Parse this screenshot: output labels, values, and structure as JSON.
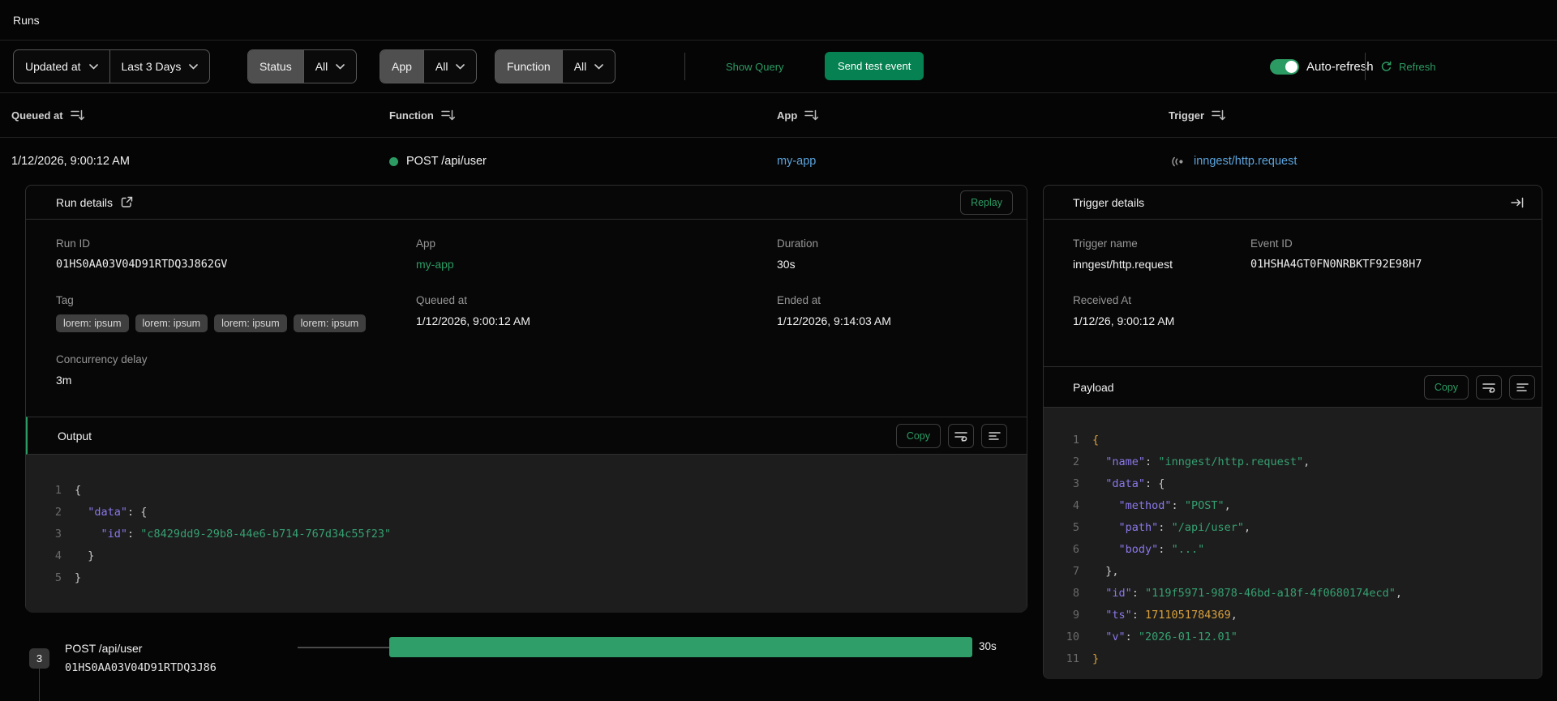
{
  "page": {
    "title": "Runs"
  },
  "colors": {
    "accent_green": "#2c9b63",
    "button_green": "#068252",
    "bar_green": "#2f9e68",
    "link_blue": "#5ba3dc",
    "code_key_purple": "#8b77e8",
    "code_string_green": "#36a071",
    "code_number_orange": "#d8a03c"
  },
  "filters": {
    "updated_at": {
      "label": "Updated at"
    },
    "time_range": {
      "label": "Last 3 Days"
    },
    "status": {
      "label": "Status",
      "value": "All"
    },
    "app": {
      "label": "App",
      "value": "All"
    },
    "function": {
      "label": "Function",
      "value": "All"
    },
    "show_query": "Show Query",
    "send_test_event": "Send test event",
    "auto_refresh": "Auto-refresh",
    "refresh": "Refresh"
  },
  "table": {
    "columns": [
      "Queued at",
      "Function",
      "App",
      "Trigger"
    ],
    "row": {
      "queued_at": "1/12/2026, 9:00:12 AM",
      "function": "POST /api/user",
      "app": "my-app",
      "trigger": "inngest/http.request"
    }
  },
  "run_details": {
    "title": "Run details",
    "replay": "Replay",
    "fields": {
      "run_id": {
        "label": "Run ID",
        "value": "01HS0AA03V04D91RTDQ3J862GV"
      },
      "app": {
        "label": "App",
        "value": "my-app"
      },
      "duration": {
        "label": "Duration",
        "value": "30s"
      },
      "tag": {
        "label": "Tag",
        "chips": [
          "lorem: ipsum",
          "lorem: ipsum",
          "lorem: ipsum",
          "lorem: ipsum"
        ]
      },
      "queued_at": {
        "label": "Queued at",
        "value": "1/12/2026, 9:00:12 AM"
      },
      "ended_at": {
        "label": "Ended at",
        "value": "1/12/2026, 9:14:03 AM"
      },
      "concurrency_delay": {
        "label": "Concurrency delay",
        "value": "3m"
      }
    },
    "output": {
      "title": "Output",
      "copy": "Copy",
      "lines": [
        [
          {
            "c": "pu",
            "t": "{"
          }
        ],
        [
          {
            "c": "pu",
            "t": "  "
          },
          {
            "c": "ke",
            "t": "\"data\""
          },
          {
            "c": "pu",
            "t": ": {"
          }
        ],
        [
          {
            "c": "pu",
            "t": "    "
          },
          {
            "c": "ke",
            "t": "\"id\""
          },
          {
            "c": "pu",
            "t": ": "
          },
          {
            "c": "st",
            "t": "\"c8429dd9-29b8-44e6-b714-767d34c55f23\""
          }
        ],
        [
          {
            "c": "pu",
            "t": "  }"
          }
        ],
        [
          {
            "c": "pu",
            "t": "}"
          }
        ]
      ]
    }
  },
  "trigger_details": {
    "title": "Trigger details",
    "fields": {
      "trigger_name": {
        "label": "Trigger name",
        "value": "inngest/http.request"
      },
      "event_id": {
        "label": "Event ID",
        "value": "01HSHA4GT0FN0NRBKTF92E98H7"
      },
      "received_at": {
        "label": "Received At",
        "value": "1/12/26, 9:00:12 AM"
      }
    },
    "payload": {
      "title": "Payload",
      "copy": "Copy",
      "lines": [
        [
          {
            "c": "ob",
            "t": "{"
          }
        ],
        [
          {
            "c": "pu",
            "t": "  "
          },
          {
            "c": "ke",
            "t": "\"name\""
          },
          {
            "c": "pu",
            "t": ": "
          },
          {
            "c": "st",
            "t": "\"inngest/http.request\""
          },
          {
            "c": "pu",
            "t": ","
          }
        ],
        [
          {
            "c": "pu",
            "t": "  "
          },
          {
            "c": "ke",
            "t": "\"data\""
          },
          {
            "c": "pu",
            "t": ": {"
          }
        ],
        [
          {
            "c": "pu",
            "t": "    "
          },
          {
            "c": "ke",
            "t": "\"method\""
          },
          {
            "c": "pu",
            "t": ": "
          },
          {
            "c": "st",
            "t": "\"POST\""
          },
          {
            "c": "pu",
            "t": ","
          }
        ],
        [
          {
            "c": "pu",
            "t": "    "
          },
          {
            "c": "ke",
            "t": "\"path\""
          },
          {
            "c": "pu",
            "t": ": "
          },
          {
            "c": "st",
            "t": "\"/api/user\""
          },
          {
            "c": "pu",
            "t": ","
          }
        ],
        [
          {
            "c": "pu",
            "t": "    "
          },
          {
            "c": "ke",
            "t": "\"body\""
          },
          {
            "c": "pu",
            "t": ": "
          },
          {
            "c": "st",
            "t": "\"...\""
          }
        ],
        [
          {
            "c": "pu",
            "t": "  },"
          }
        ],
        [
          {
            "c": "pu",
            "t": "  "
          },
          {
            "c": "ke",
            "t": "\"id\""
          },
          {
            "c": "pu",
            "t": ": "
          },
          {
            "c": "st",
            "t": "\"119f5971-9878-46bd-a18f-4f0680174ecd\""
          },
          {
            "c": "pu",
            "t": ","
          }
        ],
        [
          {
            "c": "pu",
            "t": "  "
          },
          {
            "c": "ke",
            "t": "\"ts\""
          },
          {
            "c": "pu",
            "t": ": "
          },
          {
            "c": "nu",
            "t": "1711051784369"
          },
          {
            "c": "pu",
            "t": ","
          }
        ],
        [
          {
            "c": "pu",
            "t": "  "
          },
          {
            "c": "ke",
            "t": "\"v\""
          },
          {
            "c": "pu",
            "t": ": "
          },
          {
            "c": "st",
            "t": "\"2026-01-12.01\""
          }
        ],
        [
          {
            "c": "ob",
            "t": "}"
          }
        ]
      ]
    }
  },
  "timeline": {
    "badge": "3",
    "step_name": "POST /api/user",
    "step_id": "01HS0AA03V04D91RTDQ3J86",
    "duration": "30s"
  }
}
